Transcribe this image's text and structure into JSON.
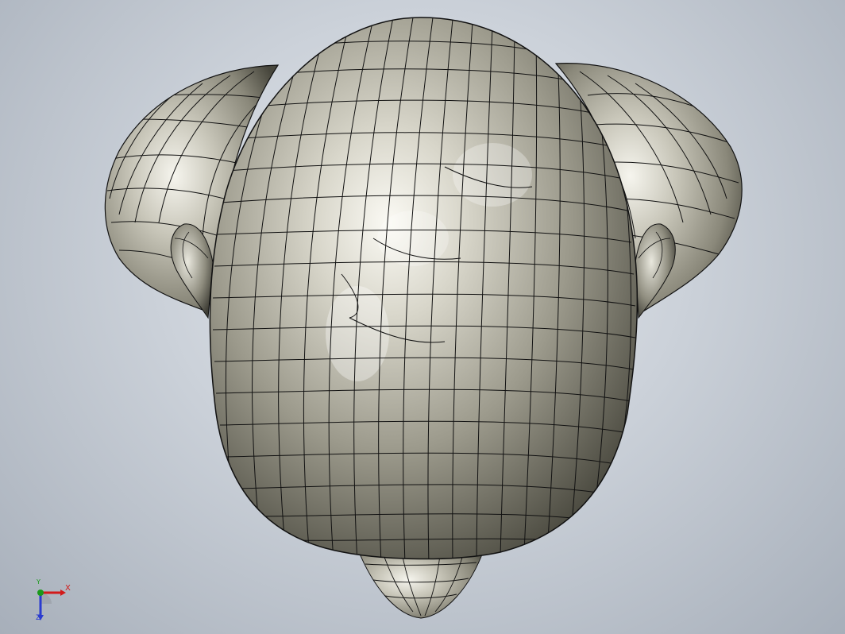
{
  "viewport": {
    "background_colors": [
      "#e6e9ee",
      "#cbd1d9",
      "#a7afba"
    ]
  },
  "model": {
    "surface_color": "#8f8d7f",
    "highlight_color": "#f2f1ea",
    "mesh_line_color": "#111111"
  },
  "triad": {
    "x_label": "X",
    "y_label": "Y",
    "z_label": "Z",
    "x_color": "#d21a1a",
    "y_color": "#1a9a1a",
    "z_color": "#2a3bd0"
  }
}
